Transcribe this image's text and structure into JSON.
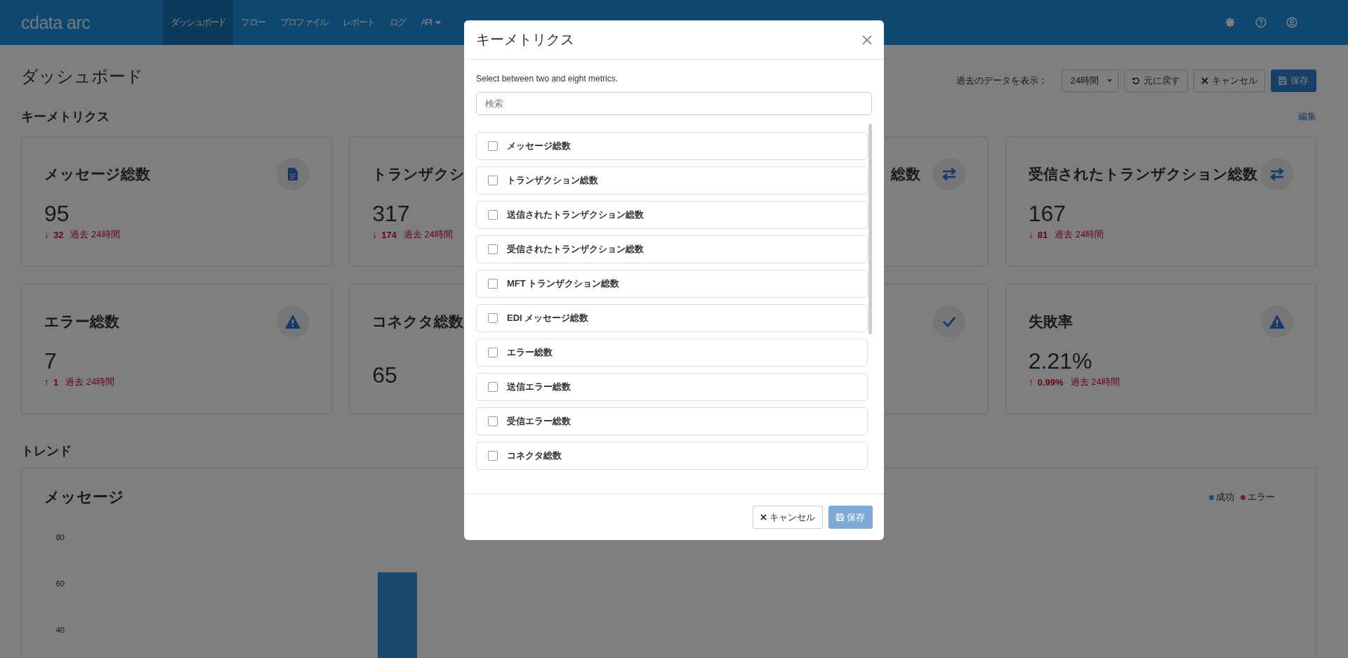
{
  "nav": {
    "logo": "cdata arc",
    "items": [
      {
        "label": "ダッシュボード",
        "selected": true,
        "dropdown": false
      },
      {
        "label": "フロー",
        "selected": false,
        "dropdown": false
      },
      {
        "label": "プロファイル",
        "selected": false,
        "dropdown": false
      },
      {
        "label": "レポート",
        "selected": false,
        "dropdown": false
      },
      {
        "label": "ログ",
        "selected": false,
        "dropdown": false
      },
      {
        "label": "API",
        "selected": false,
        "dropdown": true
      }
    ]
  },
  "page": {
    "title": "ダッシュボード",
    "range_label": "過去のデータを表示：",
    "range_select": "24時間",
    "revert": "元に戻す",
    "cancel": "キャンセル",
    "save": "保存"
  },
  "metrics": {
    "title": "キーメトリクス",
    "edit": "編集",
    "cards": [
      {
        "title": "メッセージ総数",
        "kind": "document",
        "value": "95",
        "change": {
          "arrow": "↓",
          "amount": "32",
          "period": "過去 24時間"
        }
      },
      {
        "title": "トランザクシ",
        "value": "317",
        "change": {
          "arrow": "↓",
          "amount": "174",
          "period": "過去 24時間"
        }
      },
      {
        "title": "総数",
        "kind": "transfer"
      },
      {
        "title": "受信されたトランザクション総数",
        "kind": "transfer",
        "value": "167",
        "change": {
          "arrow": "↓",
          "amount": "81",
          "period": "過去 24時間"
        }
      },
      {
        "title": "エラー総数",
        "kind": "warning",
        "value": "7",
        "change": {
          "arrow": "↑",
          "amount": "1",
          "period": "過去 24時間"
        }
      },
      {
        "title": "コネクタ総数",
        "value": "65"
      },
      {
        "kind": "check"
      },
      {
        "title": "失敗率",
        "kind": "warning",
        "value": "2.21%",
        "change": {
          "arrow": "↑",
          "amount": "0.99%",
          "period": "過去 24時間"
        }
      }
    ]
  },
  "trend": {
    "title": "トレンド",
    "chart": {
      "title": "メッセージ",
      "legend": [
        {
          "label": "成功",
          "color": "#1d4f78"
        },
        {
          "label": "エラー",
          "color": "#6e1f2a"
        }
      ],
      "y_labels": [
        "80",
        "60",
        "40"
      ]
    }
  },
  "modal": {
    "title": "キーメトリクス",
    "description": "Select between two and eight metrics.",
    "search": {
      "placeholder": "検索"
    },
    "options": [
      {
        "label": "メッセージ総数",
        "checked": false
      },
      {
        "label": "トランザクション総数",
        "checked": false
      },
      {
        "label": "送信されたトランザクション総数",
        "checked": false
      },
      {
        "label": "受信されたトランザクション総数",
        "checked": false
      },
      {
        "label": "MFT トランザクション総数",
        "checked": false
      },
      {
        "label": "EDI メッセージ総数",
        "checked": false
      },
      {
        "label": "エラー総数",
        "checked": false
      },
      {
        "label": "送信エラー総数",
        "checked": false
      },
      {
        "label": "受信エラー総数",
        "checked": false
      },
      {
        "label": "コネクタ総数",
        "checked": false
      }
    ],
    "cancel": "キャンセル",
    "save": "保存",
    "save_disabled": true
  }
}
